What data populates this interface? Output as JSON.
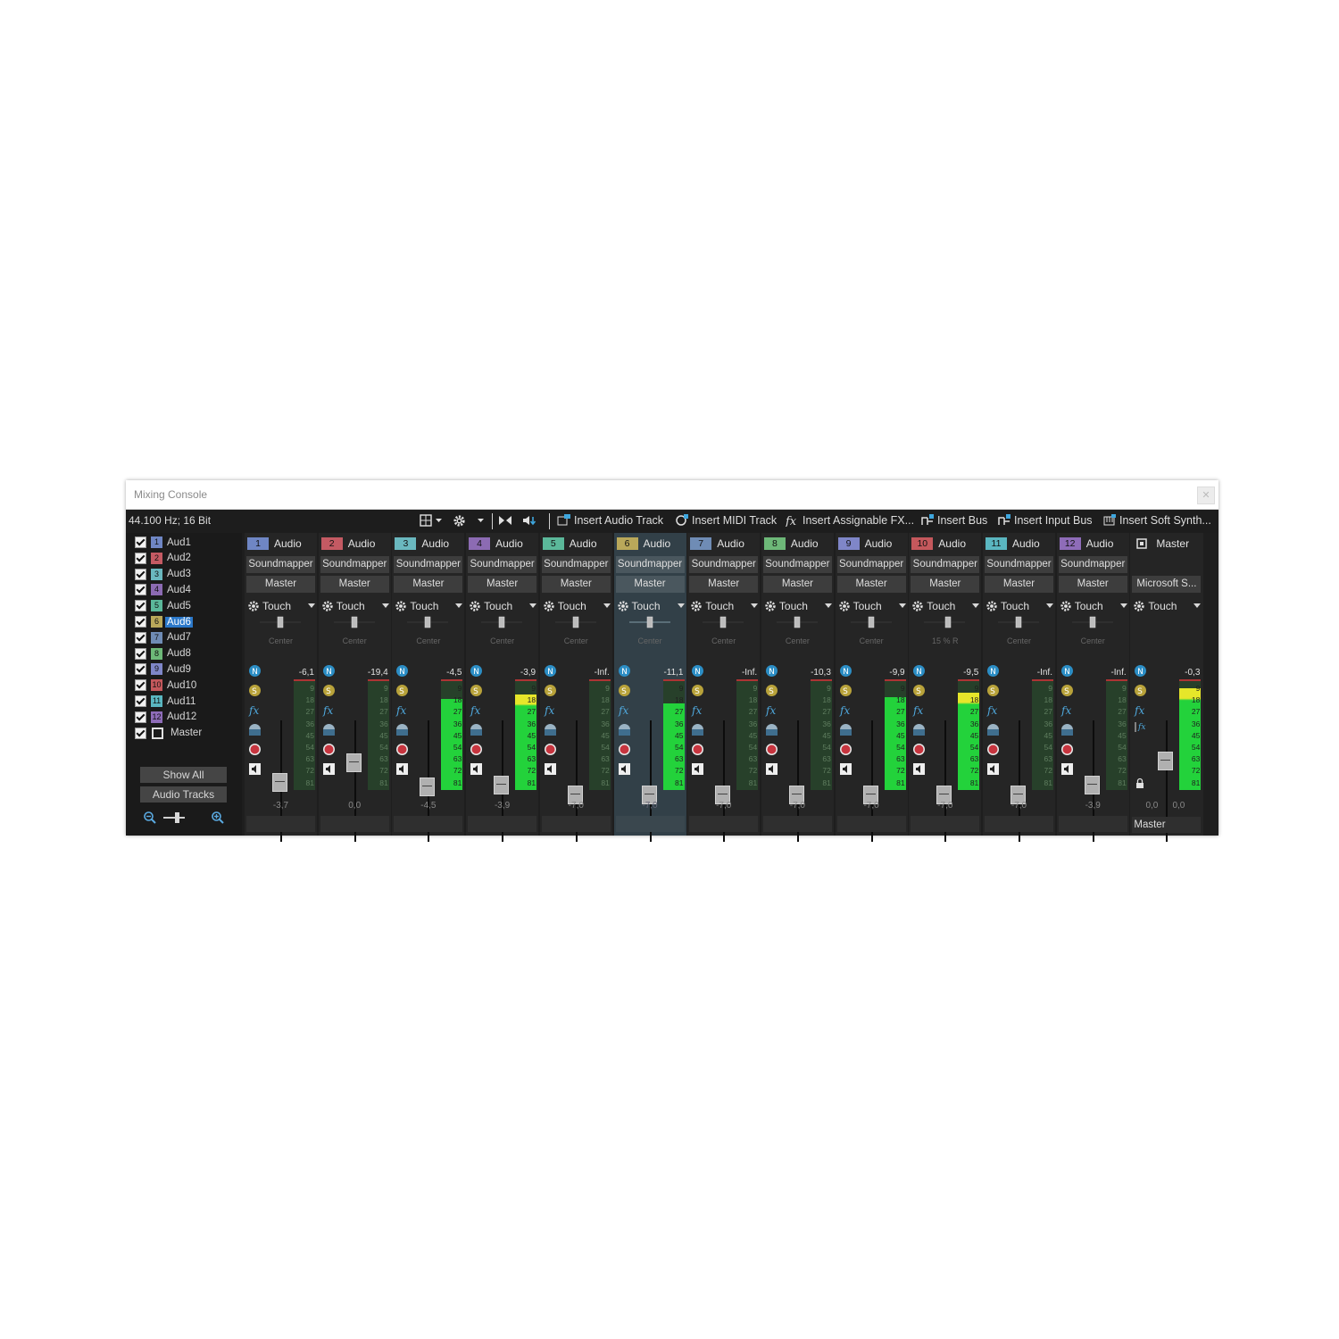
{
  "window": {
    "title": "Mixing Console"
  },
  "toolbar": {
    "sample_rate": "44.100 Hz; 16 Bit",
    "view_icon": "grid-view-icon",
    "settings_icon": "gear-icon",
    "insert_audio_track": "Insert Audio Track",
    "insert_midi_track": "Insert MIDI Track",
    "insert_assignable_fx": "Insert Assignable FX...",
    "insert_bus": "Insert Bus",
    "insert_input_bus": "Insert Input Bus",
    "insert_soft_synth": "Insert Soft Synth..."
  },
  "tracklist": {
    "items": [
      {
        "num": "1",
        "label": "Aud1",
        "color": "#6f86c4",
        "checked": true,
        "selected": false
      },
      {
        "num": "2",
        "label": "Aud2",
        "color": "#c45a63",
        "checked": true,
        "selected": false
      },
      {
        "num": "3",
        "label": "Aud3",
        "color": "#6ab8bf",
        "checked": true,
        "selected": false
      },
      {
        "num": "4",
        "label": "Aud4",
        "color": "#8c6bb3",
        "checked": true,
        "selected": false
      },
      {
        "num": "5",
        "label": "Aud5",
        "color": "#5bb89a",
        "checked": true,
        "selected": false
      },
      {
        "num": "6",
        "label": "Aud6",
        "color": "#b9a85a",
        "checked": true,
        "selected": true
      },
      {
        "num": "7",
        "label": "Aud7",
        "color": "#6f8cb5",
        "checked": true,
        "selected": false
      },
      {
        "num": "8",
        "label": "Aud8",
        "color": "#6db878",
        "checked": true,
        "selected": false
      },
      {
        "num": "9",
        "label": "Aud9",
        "color": "#7f86c8",
        "checked": true,
        "selected": false
      },
      {
        "num": "10",
        "label": "Aud10",
        "color": "#c4585c",
        "checked": true,
        "selected": false
      },
      {
        "num": "11",
        "label": "Aud11",
        "color": "#5ab6c0",
        "checked": true,
        "selected": false
      },
      {
        "num": "12",
        "label": "Aud12",
        "color": "#8e6cb8",
        "checked": true,
        "selected": false
      },
      {
        "num": "",
        "label": "Master",
        "color": "#ffffff",
        "checked": true,
        "selected": false
      }
    ],
    "show_all": "Show All",
    "audio_tracks": "Audio Tracks"
  },
  "strips": [
    {
      "num": "1",
      "color": "#6f86c4",
      "type": "Audio",
      "device": "Soundmapper",
      "output": "Master",
      "automation": "Touch",
      "pan": "Center",
      "peak": "-6,1",
      "gain": "-3,7",
      "fader": 0.5,
      "meter": 0.0,
      "selected": false
    },
    {
      "num": "2",
      "color": "#c45a63",
      "type": "Audio",
      "device": "Soundmapper",
      "output": "Master",
      "automation": "Touch",
      "pan": "Center",
      "peak": "-19,4",
      "gain": "0,0",
      "fader": 0.68,
      "meter": 0.0,
      "selected": false
    },
    {
      "num": "3",
      "color": "#6ab8bf",
      "type": "Audio",
      "device": "Soundmapper",
      "output": "Master",
      "automation": "Touch",
      "pan": "Center",
      "peak": "-4,5",
      "gain": "-4,5",
      "fader": 0.45,
      "meter": 0.82,
      "selected": false
    },
    {
      "num": "4",
      "color": "#8c6bb3",
      "type": "Audio",
      "device": "Soundmapper",
      "output": "Master",
      "automation": "Touch",
      "pan": "Center",
      "peak": "-3,9",
      "gain": "-3,9",
      "fader": 0.47,
      "meter": 0.86,
      "selected": false
    },
    {
      "num": "5",
      "color": "#5bb89a",
      "type": "Audio",
      "device": "Soundmapper",
      "output": "Master",
      "automation": "Touch",
      "pan": "Center",
      "peak": "-Inf.",
      "gain": "-7,0",
      "fader": 0.38,
      "meter": 0.0,
      "selected": false
    },
    {
      "num": "6",
      "color": "#b9a85a",
      "type": "Audio",
      "device": "Soundmapper",
      "output": "Master",
      "automation": "Touch",
      "pan": "Center",
      "peak": "-11,1",
      "gain": "-7,0",
      "fader": 0.38,
      "meter": 0.78,
      "selected": true
    },
    {
      "num": "7",
      "color": "#6f8cb5",
      "type": "Audio",
      "device": "Soundmapper",
      "output": "Master",
      "automation": "Touch",
      "pan": "Center",
      "peak": "-Inf.",
      "gain": "-7,0",
      "fader": 0.38,
      "meter": 0.0,
      "selected": false
    },
    {
      "num": "8",
      "color": "#6db878",
      "type": "Audio",
      "device": "Soundmapper",
      "output": "Master",
      "automation": "Touch",
      "pan": "Center",
      "peak": "-10,3",
      "gain": "-7,0",
      "fader": 0.38,
      "meter": 0.0,
      "selected": false
    },
    {
      "num": "9",
      "color": "#7f86c8",
      "type": "Audio",
      "device": "Soundmapper",
      "output": "Master",
      "automation": "Touch",
      "pan": "Center",
      "peak": "-9,9",
      "gain": "-7,0",
      "fader": 0.38,
      "meter": 0.84,
      "selected": false
    },
    {
      "num": "10",
      "color": "#c4585c",
      "type": "Audio",
      "device": "Soundmapper",
      "output": "Master",
      "automation": "Touch",
      "pan": "15 % R",
      "peak": "-9,5",
      "gain": "-7,0",
      "fader": 0.38,
      "meter": 0.88,
      "selected": false
    },
    {
      "num": "11",
      "color": "#5ab6c0",
      "type": "Audio",
      "device": "Soundmapper",
      "output": "Master",
      "automation": "Touch",
      "pan": "Center",
      "peak": "-Inf.",
      "gain": "-7,0",
      "fader": 0.38,
      "meter": 0.0,
      "selected": false
    },
    {
      "num": "12",
      "color": "#8e6cb8",
      "type": "Audio",
      "device": "Soundmapper",
      "output": "Master",
      "automation": "Touch",
      "pan": "Center",
      "peak": "-Inf.",
      "gain": "-3,9",
      "fader": 0.47,
      "meter": 0.0,
      "selected": false
    }
  ],
  "master": {
    "label": "Master",
    "device": "Microsoft S...",
    "automation": "Touch",
    "peak": "-0,3",
    "gain_left": "0,0",
    "gain_right": "0,0",
    "footer": "Master",
    "fader": 0.7,
    "meter": 0.92
  },
  "meter_ticks": [
    "9",
    "18",
    "27",
    "36",
    "45",
    "54",
    "63",
    "72",
    "81"
  ]
}
